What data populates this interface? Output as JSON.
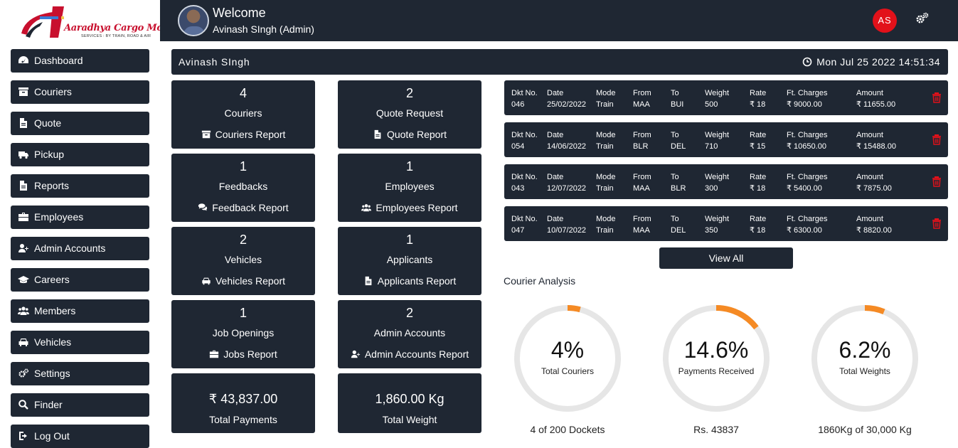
{
  "logo": {
    "name": "Aaradhya Cargo Movers",
    "tagline": "SERVICES : BY TRAIN, ROAD & AIR"
  },
  "header": {
    "welcome": "Welcome",
    "user": "Avinash SIngh (Admin)",
    "initials": "AS"
  },
  "sidebar": [
    {
      "label": "Dashboard",
      "icon": "dashboard-icon"
    },
    {
      "label": "Couriers",
      "icon": "archive-icon"
    },
    {
      "label": "Quote",
      "icon": "document-icon"
    },
    {
      "label": "Pickup",
      "icon": "truck-icon"
    },
    {
      "label": "Reports",
      "icon": "document-icon"
    },
    {
      "label": "Employees",
      "icon": "briefcase-icon"
    },
    {
      "label": "Admin Accounts",
      "icon": "user-plus-icon"
    },
    {
      "label": "Careers",
      "icon": "graduation-cap-icon"
    },
    {
      "label": "Members",
      "icon": "users-icon"
    },
    {
      "label": "Vehicles",
      "icon": "car-icon"
    },
    {
      "label": "Settings",
      "icon": "gears-icon"
    },
    {
      "label": "Finder",
      "icon": "search-icon"
    },
    {
      "label": "Log Out",
      "icon": "sign-out-icon"
    }
  ],
  "titlebar": {
    "username": "Avinash SIngh",
    "datetime": "Mon Jul 25 2022 14:51:34"
  },
  "cards": [
    {
      "count": "4",
      "label": "Couriers",
      "report": "Couriers Report",
      "icon": "archive-icon"
    },
    {
      "count": "2",
      "label": "Quote Request",
      "report": "Quote Report",
      "icon": "document-icon"
    },
    {
      "count": "1",
      "label": "Feedbacks",
      "report": "Feedback Report",
      "icon": "comments-icon"
    },
    {
      "count": "1",
      "label": "Employees",
      "report": "Employees Report",
      "icon": "users-icon"
    },
    {
      "count": "2",
      "label": "Vehicles",
      "report": "Vehicles Report",
      "icon": "car-icon"
    },
    {
      "count": "1",
      "label": "Applicants",
      "report": "Applicants Report",
      "icon": "document-icon"
    },
    {
      "count": "1",
      "label": "Job Openings",
      "report": "Jobs Report",
      "icon": "briefcase-icon"
    },
    {
      "count": "2",
      "label": "Admin Accounts",
      "report": "Admin Accounts Report",
      "icon": "user-plus-icon"
    }
  ],
  "totals": [
    {
      "value": "₹ 43,837.00",
      "label": "Total Payments"
    },
    {
      "value": "1,860.00 Kg",
      "label": "Total Weight"
    }
  ],
  "docket_headers": [
    "Dkt No.",
    "Date",
    "Mode",
    "From",
    "To",
    "Weight",
    "Rate",
    "Ft. Charges",
    "Amount"
  ],
  "dockets": [
    [
      "046",
      "25/02/2022",
      "Train",
      "MAA",
      "BUI",
      "500",
      "₹ 18",
      "₹ 9000.00",
      "₹ 11655.00"
    ],
    [
      "054",
      "14/06/2022",
      "Train",
      "BLR",
      "DEL",
      "710",
      "₹ 15",
      "₹ 10650.00",
      "₹ 15488.00"
    ],
    [
      "043",
      "12/07/2022",
      "Train",
      "MAA",
      "BLR",
      "300",
      "₹ 18",
      "₹ 5400.00",
      "₹ 7875.00"
    ],
    [
      "047",
      "10/07/2022",
      "Train",
      "MAA",
      "DEL",
      "350",
      "₹ 18",
      "₹ 6300.00",
      "₹ 8820.00"
    ]
  ],
  "view_all": "View All",
  "analysis": {
    "title": "Courier Analysis",
    "gauges": [
      {
        "percent": 4,
        "percent_text": "4%",
        "label": "Total Couriers",
        "caption": "4 of 200 Dockets"
      },
      {
        "percent": 14.6,
        "percent_text": "14.6%",
        "label": "Payments Received",
        "caption": "Rs. 43837"
      },
      {
        "percent": 6.2,
        "percent_text": "6.2%",
        "label": "Total Weights",
        "caption": "1860Kg of 30,000 Kg"
      }
    ]
  },
  "colors": {
    "panel": "#1f2733",
    "accent": "#f58a24",
    "track": "#e6e6e6",
    "danger": "#e2111a"
  }
}
